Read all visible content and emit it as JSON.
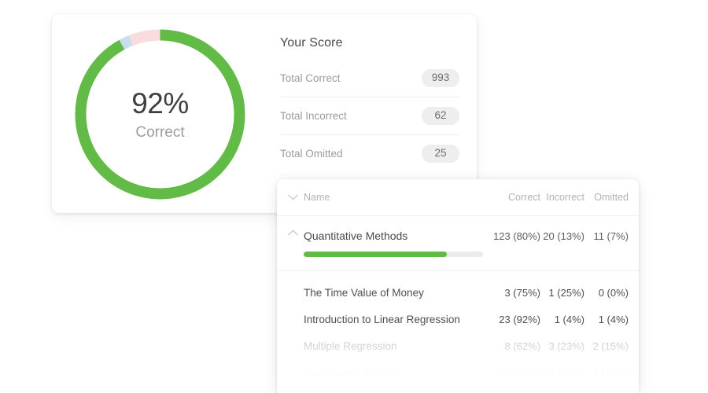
{
  "theme": {
    "green": "#62bb46",
    "blue": "#c9ddf0",
    "pink": "#f9dcdc",
    "track": "#ebebeb",
    "text_dark": "#4a4a4a",
    "text_muted": "#9b9b9b",
    "badge_bg": "#eeeeee",
    "page_bg": "#ffffff"
  },
  "donut": {
    "percent_label": "92%",
    "caption": "Correct",
    "segments": [
      {
        "name": "correct",
        "value": 92,
        "color": "#62bb46"
      },
      {
        "name": "omitted",
        "value": 2,
        "color": "#c9ddf0"
      },
      {
        "name": "incorrect",
        "value": 6,
        "color": "#f9dcdc"
      }
    ]
  },
  "score": {
    "title": "Your Score",
    "rows": [
      {
        "label": "Total Correct",
        "value": "993"
      },
      {
        "label": "Total Incorrect",
        "value": "62"
      },
      {
        "label": "Total Omitted",
        "value": "25"
      }
    ]
  },
  "topics": {
    "header": {
      "name": "Name",
      "correct": "Correct",
      "incorrect": "Incorrect",
      "omitted": "Omitted",
      "collapse_icon": "chevron-down-icon"
    },
    "group": {
      "name": "Quantitative Methods",
      "correct": "123 (80%)",
      "incorrect": "20 (13%)",
      "omitted": "11 (7%)",
      "expand_icon": "chevron-up-icon",
      "progress_percent": 80
    },
    "children": [
      {
        "name": "The Time Value of Money",
        "correct": "3 (75%)",
        "incorrect": "1 (25%)",
        "omitted": "0 (0%)"
      },
      {
        "name": "Introduction to Linear Regression",
        "correct": "23 (92%)",
        "incorrect": "1 (4%)",
        "omitted": "1 (4%)"
      },
      {
        "name": "Multiple Regression",
        "correct": "8 (62%)",
        "incorrect": "3 (23%)",
        "omitted": "2 (15%)"
      },
      {
        "name": "Time-Series Analysis",
        "correct": "18 (72%)",
        "incorrect": "4 (16%)",
        "omitted": "3 (12%)"
      }
    ]
  },
  "chart_data": {
    "type": "pie",
    "title": "Your Score",
    "labels": [
      "Correct",
      "Incorrect",
      "Omitted"
    ],
    "values": [
      993,
      62,
      25
    ],
    "percents": [
      92,
      6,
      2
    ],
    "colors": [
      "#62bb46",
      "#f9dcdc",
      "#c9ddf0"
    ],
    "center_label": "92%",
    "center_sublabel": "Correct",
    "donut": true,
    "legend": "none",
    "table": {
      "columns": [
        "Name",
        "Correct",
        "Incorrect",
        "Omitted"
      ],
      "rows": [
        [
          "Quantitative Methods",
          "123 (80%)",
          "20 (13%)",
          "11 (7%)"
        ],
        [
          "The Time Value of Money",
          "3 (75%)",
          "1 (25%)",
          "0 (0%)"
        ],
        [
          "Introduction to Linear Regression",
          "23 (92%)",
          "1 (4%)",
          "1 (4%)"
        ],
        [
          "Multiple Regression",
          "8 (62%)",
          "3 (23%)",
          "2 (15%)"
        ],
        [
          "Time-Series Analysis",
          "18 (72%)",
          "4 (16%)",
          "3 (12%)"
        ]
      ]
    }
  }
}
